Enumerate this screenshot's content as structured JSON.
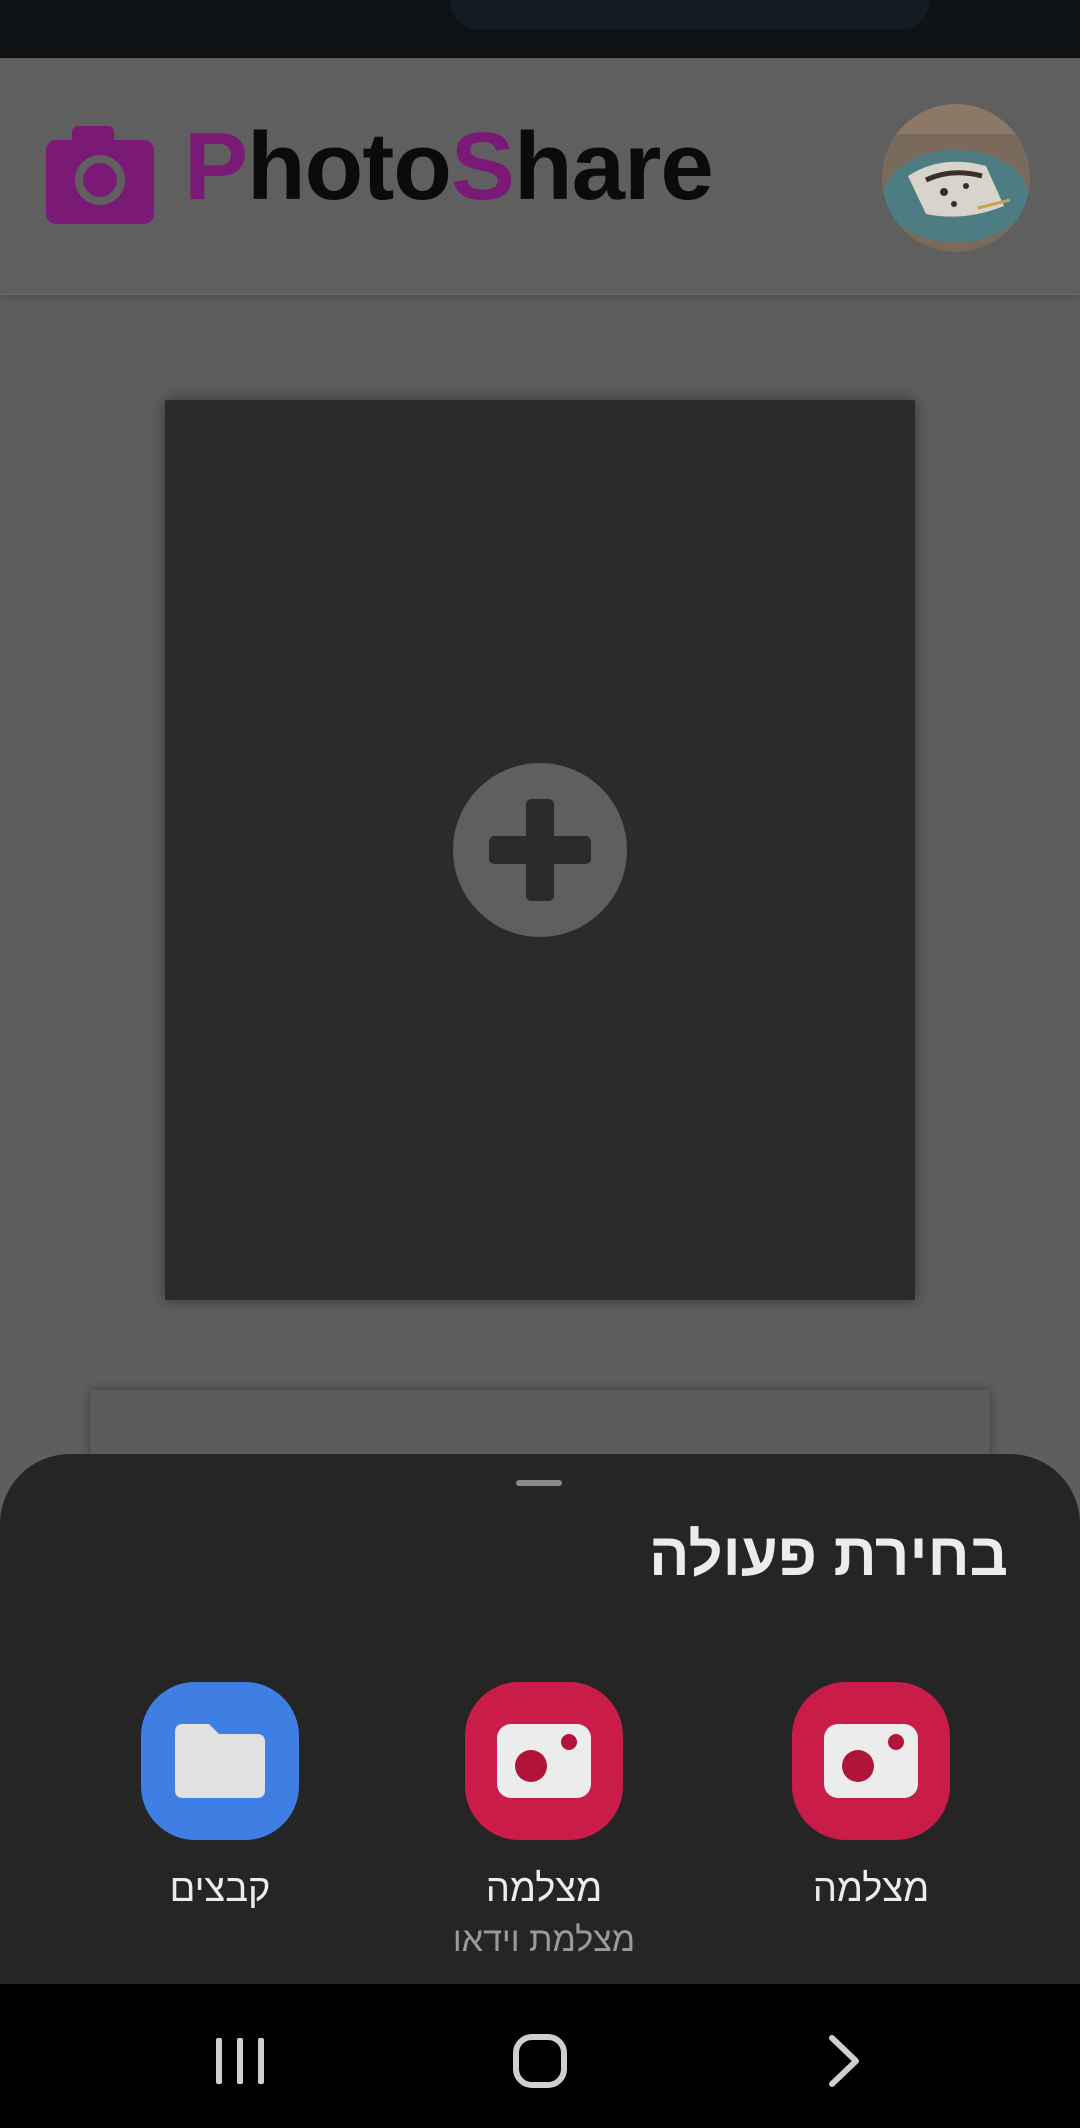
{
  "header": {
    "logo_accent_1": "P",
    "logo_part_1": "hoto",
    "logo_accent_2": "S",
    "logo_part_2": "hare",
    "logo_icon": "camera-icon",
    "accent_color": "#7b1a76"
  },
  "upload": {
    "add_icon": "plus-circle-icon"
  },
  "sheet": {
    "title": "בחירת פעולה",
    "options": [
      {
        "label": "מצלמה",
        "sublabel": "",
        "icon": "camera-app-icon",
        "color": "#c91c49"
      },
      {
        "label": "מצלמה",
        "sublabel": "מצלמת וידאו",
        "icon": "camera-app-icon",
        "color": "#c91c49"
      },
      {
        "label": "קבצים",
        "sublabel": "",
        "icon": "folder-icon",
        "color": "#3f7fe3"
      }
    ]
  },
  "nav": {
    "recents_icon": "recents-icon",
    "home_icon": "home-icon",
    "back_icon": "back-icon"
  }
}
